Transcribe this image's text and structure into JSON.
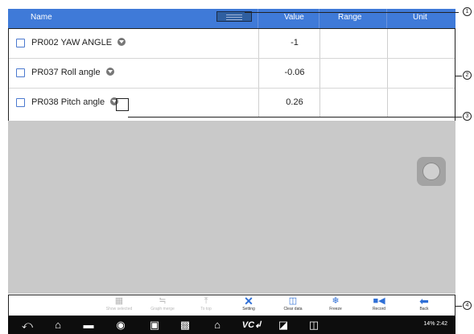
{
  "header": {
    "name_label": "Name",
    "value_label": "Value",
    "range_label": "Range",
    "unit_label": "Unit"
  },
  "rows": [
    {
      "name": "PR002  YAW ANGLE",
      "value": "-1",
      "range": "",
      "unit": ""
    },
    {
      "name": "PR037  Roll angle",
      "value": "-0.06",
      "range": "",
      "unit": ""
    },
    {
      "name": "PR038  Pitch angle",
      "value": "0.26",
      "range": "",
      "unit": ""
    }
  ],
  "toolbar": {
    "items": [
      {
        "label": "Show selected",
        "icon": "checkbox-icon",
        "enabled": false
      },
      {
        "label": "Graph merge",
        "icon": "graph-icon",
        "enabled": false
      },
      {
        "label": "To top",
        "icon": "to-top-icon",
        "enabled": false
      },
      {
        "label": "Setting",
        "icon": "wrench-icon",
        "enabled": true
      },
      {
        "label": "Clear data",
        "icon": "trash-icon",
        "enabled": true
      },
      {
        "label": "Freeze",
        "icon": "snowflake-icon",
        "enabled": true
      },
      {
        "label": "Record",
        "icon": "video-icon",
        "enabled": true
      },
      {
        "label": "Back",
        "icon": "back-arrow-icon",
        "enabled": true
      }
    ]
  },
  "status_bar": {
    "battery": "14%",
    "time": "2:42",
    "text": "14% 2:42"
  },
  "callouts": [
    "1",
    "2",
    "3",
    "4"
  ],
  "colors": {
    "header": "#3f7ad8",
    "accent": "#2f6fd6",
    "gray_area": "#c9c9c9",
    "navbar": "#0d0d0d"
  }
}
